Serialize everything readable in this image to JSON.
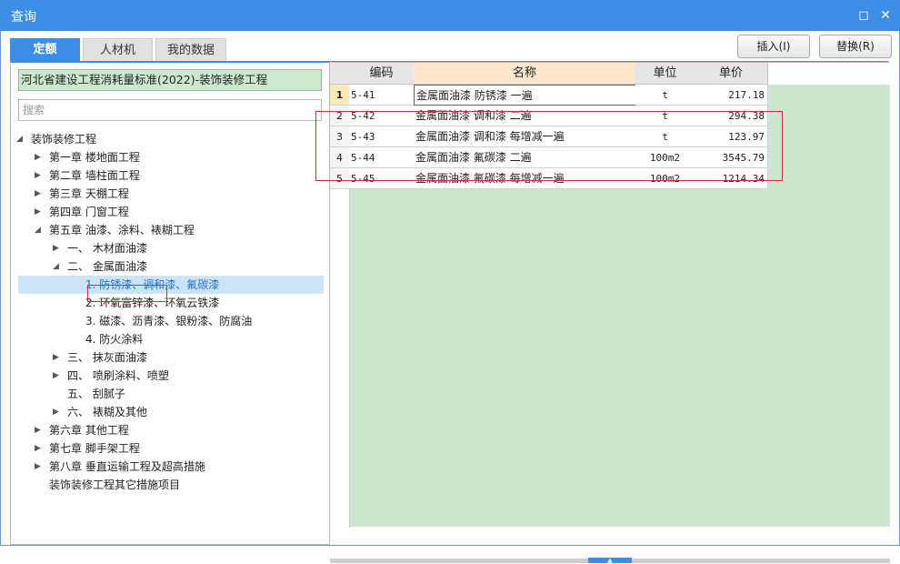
{
  "window": {
    "title": "查询",
    "restore_icon": "restore-icon",
    "close_icon": "close-icon"
  },
  "tabs": [
    {
      "label": "定额",
      "active": true
    },
    {
      "label": "人材机",
      "active": false
    },
    {
      "label": "我的数据",
      "active": false
    }
  ],
  "toolbar": {
    "insert_label": "插入(I)",
    "replace_label": "替换(R)"
  },
  "left": {
    "standard": "河北省建设工程消耗量标准(2022)-装饰装修工程",
    "search_placeholder": "搜索",
    "tree": [
      {
        "label": "装饰装修工程",
        "toggle": "expanded",
        "level": 0
      },
      {
        "label": "第一章 楼地面工程",
        "toggle": "collapsed",
        "level": 1
      },
      {
        "label": "第二章 墙柱面工程",
        "toggle": "collapsed",
        "level": 1
      },
      {
        "label": "第三章 天棚工程",
        "toggle": "collapsed",
        "level": 1
      },
      {
        "label": "第四章 门窗工程",
        "toggle": "collapsed",
        "level": 1
      },
      {
        "label": "第五章 油漆、涂料、裱糊工程",
        "toggle": "expanded",
        "level": 1
      },
      {
        "label": "一、 木材面油漆",
        "toggle": "collapsed",
        "level": 2
      },
      {
        "label": "二、 金属面油漆",
        "toggle": "expanded",
        "level": 2,
        "highlighted": true
      },
      {
        "label": "1. 防锈漆、调和漆、氟碳漆",
        "toggle": "none",
        "level": 3,
        "selected": true
      },
      {
        "label": "2. 环氧富锌漆、环氧云铁漆",
        "toggle": "none",
        "level": 3
      },
      {
        "label": "3. 磁漆、沥青漆、银粉漆、防腐油",
        "toggle": "none",
        "level": 3
      },
      {
        "label": "4. 防火涂料",
        "toggle": "none",
        "level": 3
      },
      {
        "label": "三、 抹灰面油漆",
        "toggle": "collapsed",
        "level": 2
      },
      {
        "label": "四、 喷刷涂料、喷塑",
        "toggle": "collapsed",
        "level": 2
      },
      {
        "label": "五、 刮腻子",
        "toggle": "none",
        "level": 2
      },
      {
        "label": "六、 裱糊及其他",
        "toggle": "collapsed",
        "level": 2
      },
      {
        "label": "第六章 其他工程",
        "toggle": "collapsed",
        "level": 1
      },
      {
        "label": "第七章 脚手架工程",
        "toggle": "collapsed",
        "level": 1
      },
      {
        "label": "第八章 垂直运输工程及超高措施",
        "toggle": "collapsed",
        "level": 1
      },
      {
        "label": "装饰装修工程其它措施项目",
        "toggle": "none",
        "level": 1
      }
    ]
  },
  "grid": {
    "columns": [
      "编码",
      "名称",
      "单位",
      "单价"
    ],
    "rows": [
      {
        "num": "1",
        "code": "5-41",
        "name": "金属面油漆 防锈漆 一遍",
        "unit": "t",
        "price": "217.18"
      },
      {
        "num": "2",
        "code": "5-42",
        "name": "金属面油漆 调和漆 二遍",
        "unit": "t",
        "price": "294.38"
      },
      {
        "num": "3",
        "code": "5-43",
        "name": "金属面油漆 调和漆 每增减一遍",
        "unit": "t",
        "price": "123.97"
      },
      {
        "num": "4",
        "code": "5-44",
        "name": "金属面油漆 氟碳漆 二遍",
        "unit": "100m2",
        "price": "3545.79"
      },
      {
        "num": "5",
        "code": "5-45",
        "name": "金属面油漆 氟碳漆 每增减一遍",
        "unit": "100m2",
        "price": "1214.34"
      }
    ]
  },
  "colors": {
    "accent": "#3d8ee6",
    "highlight_box": "#d92b2b",
    "grid_bg": "#cde6d0",
    "selected_row": "#cce4f7"
  }
}
